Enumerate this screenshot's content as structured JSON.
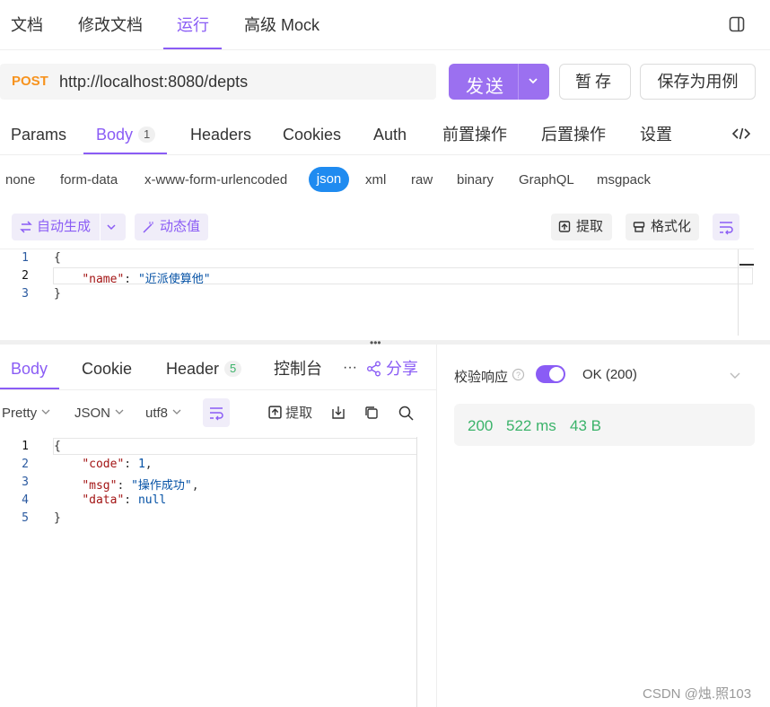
{
  "top_tabs": [
    {
      "label": "文档"
    },
    {
      "label": "修改文档"
    },
    {
      "label": "运行"
    },
    {
      "label": "高级 Mock"
    }
  ],
  "request": {
    "method": "POST",
    "url": "http://localhost:8080/depts",
    "send_label": "发送",
    "save_label": "暂存",
    "save_example_label": "保存为用例"
  },
  "request_tabs": [
    {
      "label": "Params"
    },
    {
      "label": "Body",
      "badge": "1"
    },
    {
      "label": "Headers"
    },
    {
      "label": "Cookies"
    },
    {
      "label": "Auth"
    },
    {
      "label": "前置操作"
    },
    {
      "label": "后置操作"
    },
    {
      "label": "设置"
    }
  ],
  "body_types": [
    "none",
    "form-data",
    "x-www-form-urlencoded",
    "json",
    "xml",
    "raw",
    "binary",
    "GraphQL",
    "msgpack"
  ],
  "editor_toolbar": {
    "auto_generate": "自动生成",
    "dynamic_value": "动态值",
    "extract": "提取",
    "format": "格式化"
  },
  "request_body_lines": [
    {
      "num": "1",
      "text": "{"
    },
    {
      "num": "2",
      "key": "\"name\"",
      "sep": ": ",
      "value": "\"近派使算他\""
    },
    {
      "num": "3",
      "text": "}"
    }
  ],
  "response_tabs": [
    {
      "label": "Body"
    },
    {
      "label": "Cookie"
    },
    {
      "label": "Header",
      "badge": "5"
    },
    {
      "label": "控制台"
    }
  ],
  "share_label": "分享",
  "response_toolbar": {
    "view": "Pretty",
    "format": "JSON",
    "encoding": "utf8",
    "extract": "提取"
  },
  "response_body_lines": [
    {
      "num": "1",
      "text": "{"
    },
    {
      "num": "2",
      "key": "\"code\"",
      "sep": ": ",
      "value": "1",
      "tail": ","
    },
    {
      "num": "3",
      "key": "\"msg\"",
      "sep": ": ",
      "value": "\"操作成功\"",
      "tail": ","
    },
    {
      "num": "4",
      "key": "\"data\"",
      "sep": ": ",
      "value": "null",
      "tail": ""
    },
    {
      "num": "5",
      "text": "}"
    }
  ],
  "validation": {
    "label": "校验响应",
    "status": "OK (200)",
    "toggle_on": true
  },
  "metrics": {
    "status_code": "200",
    "time": "522 ms",
    "size": "43 B"
  },
  "watermark": "CSDN @烛.照103",
  "colors": {
    "accent": "#8a5cf5",
    "method": "#f7931e",
    "json_pill": "#1f8bf0",
    "metric_green": "#3bb36a"
  }
}
